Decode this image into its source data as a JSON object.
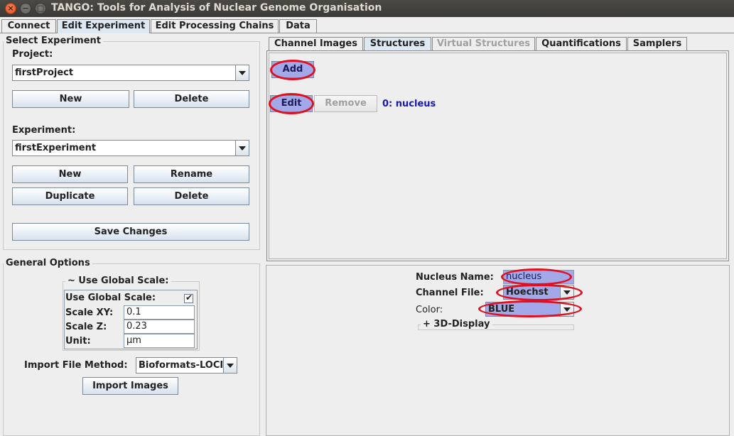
{
  "window": {
    "title": "TANGO: Tools for Analysis of Nuclear Genome Organisation",
    "close_glyph": "×",
    "minimize_glyph": "−",
    "maximize_glyph": "□"
  },
  "main_tabs": [
    {
      "label": "Connect",
      "active": false
    },
    {
      "label": "Edit Experiment",
      "active": true
    },
    {
      "label": "Edit Processing Chains",
      "active": false
    },
    {
      "label": "Data",
      "active": false
    }
  ],
  "select_experiment": {
    "title": "Select Experiment",
    "project_label": "Project:",
    "project_value": "firstProject",
    "project_new": "New",
    "project_delete": "Delete",
    "experiment_label": "Experiment:",
    "experiment_value": "firstExperiment",
    "exp_new": "New",
    "exp_rename": "Rename",
    "exp_duplicate": "Duplicate",
    "exp_delete": "Delete",
    "save_changes": "Save Changes"
  },
  "general_options": {
    "title": "General Options",
    "global_scale_title": "~ Use Global Scale:",
    "use_global_scale_label": "Use Global Scale:",
    "use_global_scale_checked": true,
    "check_glyph": "✔",
    "scale_xy_label": "Scale XY:",
    "scale_xy_value": "0.1",
    "scale_z_label": "Scale Z:",
    "scale_z_value": "0.23",
    "unit_label": "Unit:",
    "unit_value": "µm",
    "import_method_label": "Import File Method:",
    "import_method_value": "Bioformats-LOCI",
    "import_images": "Import Images"
  },
  "sub_tabs": [
    {
      "label": "Channel Images",
      "active": false,
      "enabled": true
    },
    {
      "label": "Structures",
      "active": true,
      "enabled": true
    },
    {
      "label": "Virtual Structures",
      "active": false,
      "enabled": false
    },
    {
      "label": "Quantifications",
      "active": false,
      "enabled": true
    },
    {
      "label": "Samplers",
      "active": false,
      "enabled": true
    }
  ],
  "structures": {
    "add": "Add",
    "edit": "Edit",
    "remove": "Remove",
    "item": "0: nucleus"
  },
  "structure_props": {
    "name_label": "Nucleus Name:",
    "name_value": "nucleus",
    "channel_label": "Channel File:",
    "channel_value": "Hoechst",
    "color_label": "Color:",
    "color_value": "BLUE",
    "display_3d": "+  3D-Display"
  },
  "colors": {
    "highlight_ring": "#e01020",
    "highlight_fill": "#a3a8e8",
    "active_tab": "#dde8f3",
    "link_blue": "#1818b0"
  }
}
